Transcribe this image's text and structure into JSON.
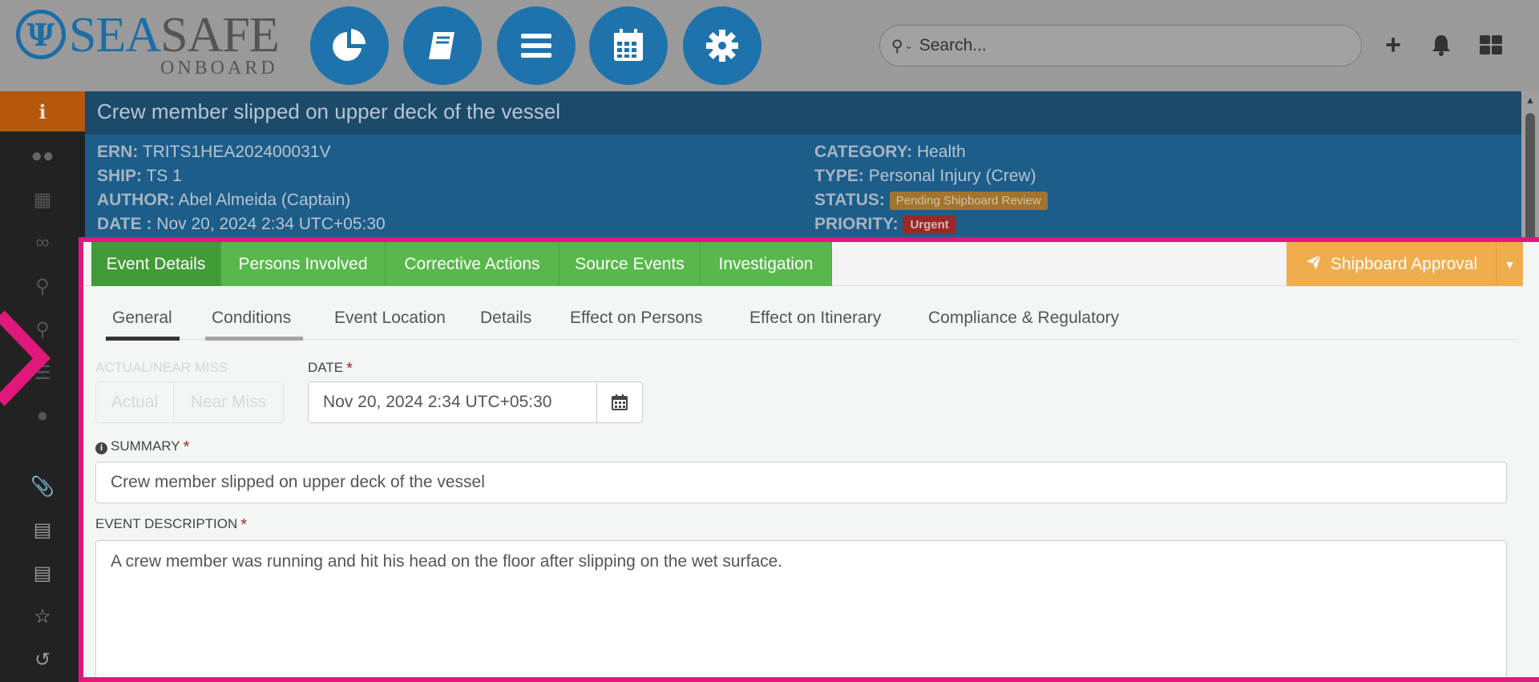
{
  "brand": {
    "word_sea": "SEA",
    "word_safe": "SAFE",
    "sub": "ONBOARD",
    "mark": "Ψ"
  },
  "topnav": {
    "items": [
      "dashboard-icon",
      "book-icon",
      "menu-icon",
      "calendar-icon",
      "settings-icon"
    ],
    "search_placeholder": "Search...",
    "actions": [
      "plus-icon",
      "bell-icon",
      "grid-icon"
    ]
  },
  "sidebar": {
    "items": [
      "info-icon",
      "users-icon",
      "sitemap-icon",
      "link-icon",
      "search-icon",
      "paperclip-icon",
      "list-icon",
      "comments-icon",
      "paperclip-icon",
      "server-icon",
      "file-text-icon",
      "star-icon",
      "history-icon"
    ],
    "active": "info-icon"
  },
  "event": {
    "title": "Crew member slipped on upper deck of the vessel",
    "erns_label": "ERN:",
    "ern": "TRITS1HEA202400031V",
    "ship_label": "SHIP:",
    "ship": "TS 1",
    "author_label": "AUTHOR:",
    "author": "Abel Almeida (Captain)",
    "date_label": "DATE :",
    "date": "Nov 20, 2024 2:34 UTC+05:30",
    "category_label": "CATEGORY:",
    "category": "Health",
    "type_label": "TYPE:",
    "type": "Personal Injury (Crew)",
    "status_label": "STATUS:",
    "status": "Pending Shipboard Review",
    "priority_label": "PRIORITY:",
    "priority": "Urgent"
  },
  "tabs": {
    "items": [
      "Event Details",
      "Persons Involved",
      "Corrective Actions",
      "Source Events",
      "Investigation"
    ],
    "active": "Event Details",
    "approval_label": "Shipboard Approval"
  },
  "subtabs": {
    "items": [
      "General",
      "Conditions",
      "Event Location",
      "Details",
      "Effect on Persons",
      "Effect on Itinerary",
      "Compliance & Regulatory"
    ],
    "active": "General"
  },
  "form": {
    "actual_near_miss_label": "ACTUAL/NEAR MISS",
    "actual_option": "Actual",
    "near_miss_option": "Near Miss",
    "date_label": "DATE",
    "date_value": "Nov 20, 2024 2:34 UTC+05:30",
    "required_mark": "*",
    "summary_label": "SUMMARY",
    "summary_value": "Crew member slipped on upper deck of the vessel",
    "description_label": "EVENT DESCRIPTION",
    "description_value": "A crew member was running and hit his head on the floor after slipping on the wet surface."
  },
  "colors": {
    "highlight": "#e0187b",
    "tab_green": "#58b84c",
    "approve_orange": "#f0ad4e",
    "nav_blue": "#1f73ad"
  }
}
